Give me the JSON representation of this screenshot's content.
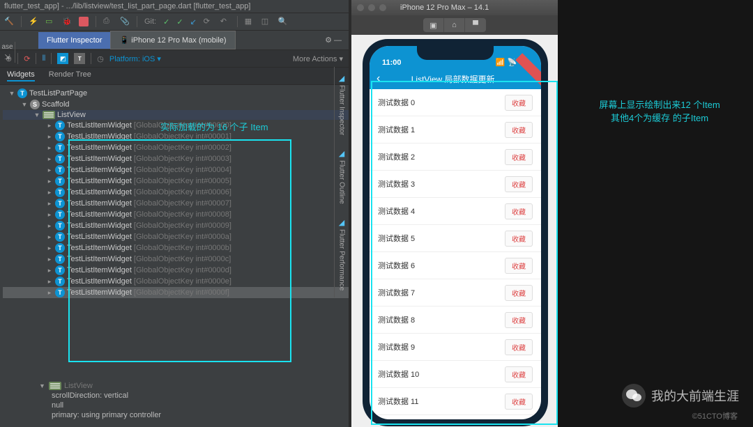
{
  "ide": {
    "title_path": "flutter_test_app] - .../lib/listview/test_list_part_page.dart [flutter_test_app]",
    "side": {
      "ase": "ase",
      "gear": "⚙"
    },
    "git_label": "Git:",
    "inspector_tab": "Flutter Inspector",
    "device_tab": "iPhone 12 Pro Max (mobile)",
    "gear": "⚙  —",
    "platform_label": "Platform: iOS ▾",
    "more_actions": "More Actions ▾",
    "widgets_tab": "Widgets",
    "render_tree_tab": "Render Tree",
    "tree": {
      "root": "TestListPartPage",
      "scaffold": "Scaffold",
      "listview": "ListView",
      "items": [
        {
          "name": "TestListItemWidget",
          "key": "[GlobalObjectKey int#00000]"
        },
        {
          "name": "TestListItemWidget",
          "key": "[GlobalObjectKey int#00001]"
        },
        {
          "name": "TestListItemWidget",
          "key": "[GlobalObjectKey int#00002]"
        },
        {
          "name": "TestListItemWidget",
          "key": "[GlobalObjectKey int#00003]"
        },
        {
          "name": "TestListItemWidget",
          "key": "[GlobalObjectKey int#00004]"
        },
        {
          "name": "TestListItemWidget",
          "key": "[GlobalObjectKey int#00005]"
        },
        {
          "name": "TestListItemWidget",
          "key": "[GlobalObjectKey int#00006]"
        },
        {
          "name": "TestListItemWidget",
          "key": "[GlobalObjectKey int#00007]"
        },
        {
          "name": "TestListItemWidget",
          "key": "[GlobalObjectKey int#00008]"
        },
        {
          "name": "TestListItemWidget",
          "key": "[GlobalObjectKey int#00009]"
        },
        {
          "name": "TestListItemWidget",
          "key": "[GlobalObjectKey int#0000a]"
        },
        {
          "name": "TestListItemWidget",
          "key": "[GlobalObjectKey int#0000b]"
        },
        {
          "name": "TestListItemWidget",
          "key": "[GlobalObjectKey int#0000c]"
        },
        {
          "name": "TestListItemWidget",
          "key": "[GlobalObjectKey int#0000d]"
        },
        {
          "name": "TestListItemWidget",
          "key": "[GlobalObjectKey int#0000e]"
        },
        {
          "name": "TestListItemWidget",
          "key": "[GlobalObjectKey int#0000f]"
        }
      ]
    },
    "detail": {
      "listview": "ListView",
      "scroll": "scrollDirection: vertical",
      "null": "null",
      "primary": "primary: using primary controller"
    },
    "vert_tabs": [
      "Flutter Inspector",
      "Flutter Outline",
      "Flutter Performance"
    ]
  },
  "annotations": {
    "left": "实际加载的为 16 个子 Item",
    "right1": "屏幕上显示绘制出来12 个Item",
    "right2": "其他4个为缓存 的子Item"
  },
  "sim": {
    "title": "iPhone 12 Pro Max – 14.1",
    "time": "11:00",
    "app_title": "ListView 局部数据更新",
    "btn": "收藏",
    "items": [
      "测试数据 0",
      "测试数据 1",
      "测试数据 2",
      "测试数据 3",
      "测试数据 4",
      "测试数据 5",
      "测试数据 6",
      "测试数据 7",
      "测试数据 8",
      "测试数据 9",
      "测试数据 10",
      "测试数据 11"
    ]
  },
  "watermark": {
    "name": "我的大前端生涯",
    "site": "©51CTO博客"
  }
}
